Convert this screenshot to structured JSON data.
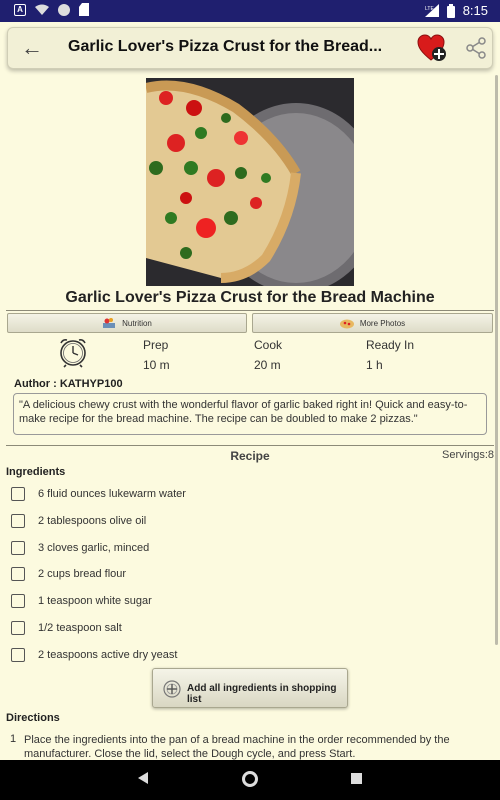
{
  "status": {
    "time": "8:15",
    "left_icons": [
      "a-notification-icon",
      "wifi-icon",
      "circle-icon",
      "sd-card-icon"
    ],
    "network": "LTE"
  },
  "appbar": {
    "title": "Garlic Lover's Pizza Crust for the Bread..."
  },
  "recipe": {
    "title": "Garlic Lover's Pizza Crust for the Bread Machine",
    "tabs": {
      "nutrition": "Nutrition",
      "more_photos": "More Photos"
    },
    "times": [
      {
        "label": "Prep",
        "value": "10 m"
      },
      {
        "label": "Cook",
        "value": "20 m"
      },
      {
        "label": "Ready In",
        "value": "1 h"
      }
    ],
    "author": "Author : KATHYP100",
    "description": "\"A delicious chewy crust with the wonderful flavor of garlic baked right in! Quick and easy-to-make recipe for the bread machine. The recipe can be doubled to make 2 pizzas.\"",
    "section_header": "Recipe",
    "servings": "Servings:8",
    "ingredients_header": "Ingredients",
    "ingredients": [
      "6 fluid ounces lukewarm water",
      "2 tablespoons olive oil",
      "3 cloves garlic, minced",
      "2 cups bread flour",
      "1 teaspoon white sugar",
      "1/2 teaspoon salt",
      "2 teaspoons active dry yeast"
    ],
    "add_button": "Add all ingredients in shopping list",
    "directions_header": "Directions",
    "directions": [
      {
        "num": "1",
        "text": "Place the ingredients into the pan of a bread machine in the order recommended by the manufacturer. Close the lid, select the Dough cycle, and press Start."
      }
    ]
  },
  "colors": {
    "background": "#fcfadf",
    "status_bar": "#1f1f6f",
    "favorite": "#d81b1b"
  }
}
